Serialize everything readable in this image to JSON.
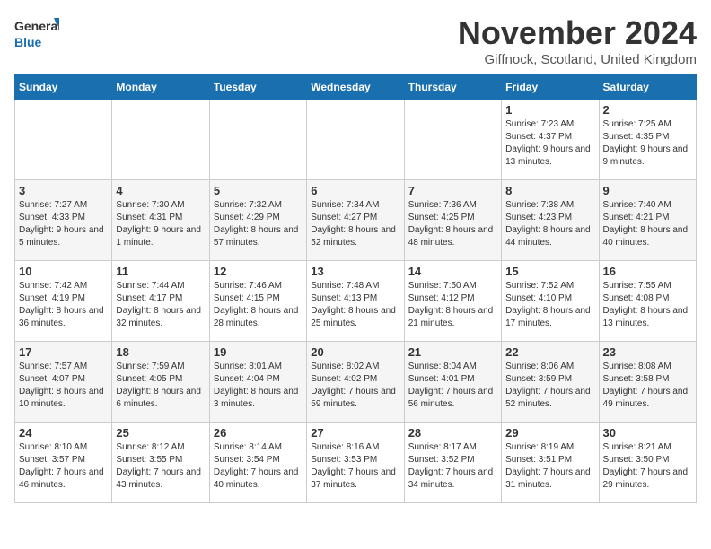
{
  "header": {
    "logo_general": "General",
    "logo_blue": "Blue",
    "month_title": "November 2024",
    "location": "Giffnock, Scotland, United Kingdom"
  },
  "weekdays": [
    "Sunday",
    "Monday",
    "Tuesday",
    "Wednesday",
    "Thursday",
    "Friday",
    "Saturday"
  ],
  "weeks": [
    [
      {
        "day": "",
        "info": ""
      },
      {
        "day": "",
        "info": ""
      },
      {
        "day": "",
        "info": ""
      },
      {
        "day": "",
        "info": ""
      },
      {
        "day": "",
        "info": ""
      },
      {
        "day": "1",
        "info": "Sunrise: 7:23 AM\nSunset: 4:37 PM\nDaylight: 9 hours and 13 minutes."
      },
      {
        "day": "2",
        "info": "Sunrise: 7:25 AM\nSunset: 4:35 PM\nDaylight: 9 hours and 9 minutes."
      }
    ],
    [
      {
        "day": "3",
        "info": "Sunrise: 7:27 AM\nSunset: 4:33 PM\nDaylight: 9 hours and 5 minutes."
      },
      {
        "day": "4",
        "info": "Sunrise: 7:30 AM\nSunset: 4:31 PM\nDaylight: 9 hours and 1 minute."
      },
      {
        "day": "5",
        "info": "Sunrise: 7:32 AM\nSunset: 4:29 PM\nDaylight: 8 hours and 57 minutes."
      },
      {
        "day": "6",
        "info": "Sunrise: 7:34 AM\nSunset: 4:27 PM\nDaylight: 8 hours and 52 minutes."
      },
      {
        "day": "7",
        "info": "Sunrise: 7:36 AM\nSunset: 4:25 PM\nDaylight: 8 hours and 48 minutes."
      },
      {
        "day": "8",
        "info": "Sunrise: 7:38 AM\nSunset: 4:23 PM\nDaylight: 8 hours and 44 minutes."
      },
      {
        "day": "9",
        "info": "Sunrise: 7:40 AM\nSunset: 4:21 PM\nDaylight: 8 hours and 40 minutes."
      }
    ],
    [
      {
        "day": "10",
        "info": "Sunrise: 7:42 AM\nSunset: 4:19 PM\nDaylight: 8 hours and 36 minutes."
      },
      {
        "day": "11",
        "info": "Sunrise: 7:44 AM\nSunset: 4:17 PM\nDaylight: 8 hours and 32 minutes."
      },
      {
        "day": "12",
        "info": "Sunrise: 7:46 AM\nSunset: 4:15 PM\nDaylight: 8 hours and 28 minutes."
      },
      {
        "day": "13",
        "info": "Sunrise: 7:48 AM\nSunset: 4:13 PM\nDaylight: 8 hours and 25 minutes."
      },
      {
        "day": "14",
        "info": "Sunrise: 7:50 AM\nSunset: 4:12 PM\nDaylight: 8 hours and 21 minutes."
      },
      {
        "day": "15",
        "info": "Sunrise: 7:52 AM\nSunset: 4:10 PM\nDaylight: 8 hours and 17 minutes."
      },
      {
        "day": "16",
        "info": "Sunrise: 7:55 AM\nSunset: 4:08 PM\nDaylight: 8 hours and 13 minutes."
      }
    ],
    [
      {
        "day": "17",
        "info": "Sunrise: 7:57 AM\nSunset: 4:07 PM\nDaylight: 8 hours and 10 minutes."
      },
      {
        "day": "18",
        "info": "Sunrise: 7:59 AM\nSunset: 4:05 PM\nDaylight: 8 hours and 6 minutes."
      },
      {
        "day": "19",
        "info": "Sunrise: 8:01 AM\nSunset: 4:04 PM\nDaylight: 8 hours and 3 minutes."
      },
      {
        "day": "20",
        "info": "Sunrise: 8:02 AM\nSunset: 4:02 PM\nDaylight: 7 hours and 59 minutes."
      },
      {
        "day": "21",
        "info": "Sunrise: 8:04 AM\nSunset: 4:01 PM\nDaylight: 7 hours and 56 minutes."
      },
      {
        "day": "22",
        "info": "Sunrise: 8:06 AM\nSunset: 3:59 PM\nDaylight: 7 hours and 52 minutes."
      },
      {
        "day": "23",
        "info": "Sunrise: 8:08 AM\nSunset: 3:58 PM\nDaylight: 7 hours and 49 minutes."
      }
    ],
    [
      {
        "day": "24",
        "info": "Sunrise: 8:10 AM\nSunset: 3:57 PM\nDaylight: 7 hours and 46 minutes."
      },
      {
        "day": "25",
        "info": "Sunrise: 8:12 AM\nSunset: 3:55 PM\nDaylight: 7 hours and 43 minutes."
      },
      {
        "day": "26",
        "info": "Sunrise: 8:14 AM\nSunset: 3:54 PM\nDaylight: 7 hours and 40 minutes."
      },
      {
        "day": "27",
        "info": "Sunrise: 8:16 AM\nSunset: 3:53 PM\nDaylight: 7 hours and 37 minutes."
      },
      {
        "day": "28",
        "info": "Sunrise: 8:17 AM\nSunset: 3:52 PM\nDaylight: 7 hours and 34 minutes."
      },
      {
        "day": "29",
        "info": "Sunrise: 8:19 AM\nSunset: 3:51 PM\nDaylight: 7 hours and 31 minutes."
      },
      {
        "day": "30",
        "info": "Sunrise: 8:21 AM\nSunset: 3:50 PM\nDaylight: 7 hours and 29 minutes."
      }
    ]
  ]
}
